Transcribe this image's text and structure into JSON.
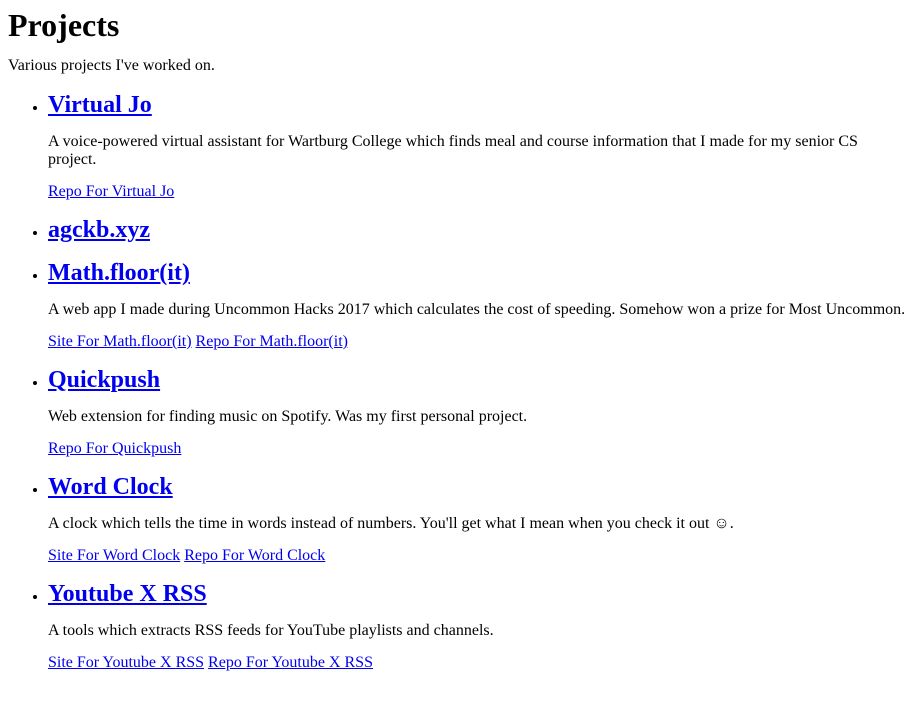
{
  "page": {
    "title": "Projects",
    "intro": "Various projects I've worked on."
  },
  "projects": [
    {
      "name": "Virtual Jo",
      "description": "A voice-powered virtual assistant for Wartburg College which finds meal and course information that I made for my senior CS project.",
      "links": [
        "Repo For Virtual Jo"
      ]
    },
    {
      "name": "agckb.xyz",
      "description": null,
      "links": []
    },
    {
      "name": "Math.floor(it)",
      "description": "A web app I made during Uncommon Hacks 2017 which calculates the cost of speeding. Somehow won a prize for Most Uncommon.",
      "links": [
        "Site For Math.floor(it)",
        "Repo For Math.floor(it)"
      ]
    },
    {
      "name": "Quickpush",
      "description": "Web extension for finding music on Spotify. Was my first personal project.",
      "links": [
        "Repo For Quickpush"
      ]
    },
    {
      "name": "Word Clock",
      "description": "A clock which tells the time in words instead of numbers. You'll get what I mean when you check it out ☺.",
      "links": [
        "Site For Word Clock",
        "Repo For Word Clock"
      ]
    },
    {
      "name": "Youtube X RSS",
      "description": "A tools which extracts RSS feeds for YouTube playlists and channels.",
      "links": [
        "Site For Youtube X RSS",
        "Repo For Youtube X RSS"
      ]
    }
  ],
  "colors": {
    "link": "#0000ee",
    "text": "#000000",
    "background": "#ffffff"
  }
}
